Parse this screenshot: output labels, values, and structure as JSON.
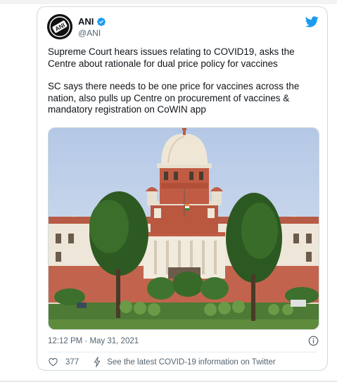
{
  "account": {
    "display_name": "ANI",
    "handle": "@ANI",
    "avatar_text": "ANI"
  },
  "tweet": {
    "paragraphs": [
      "Supreme Court hears issues relating to COVID19, asks the Centre about rationale for dual price policy for vaccines",
      "SC says there needs to be one price for vaccines across the nation, also pulls up Centre on procurement of vaccines & mandatory registration on CoWIN app"
    ],
    "timestamp": "12:12 PM · May 31, 2021"
  },
  "actions": {
    "like_count": "377",
    "covid_info_label": "See the latest COVID-19 information on Twitter"
  },
  "colors": {
    "twitter_blue": "#1d9bf0",
    "text_primary": "#0f1419",
    "text_secondary": "#536471",
    "border": "#cfd9de"
  },
  "icons": [
    "verified-badge-icon",
    "twitter-bird-icon",
    "info-icon",
    "like-heart-icon",
    "covid-bolt-icon"
  ]
}
